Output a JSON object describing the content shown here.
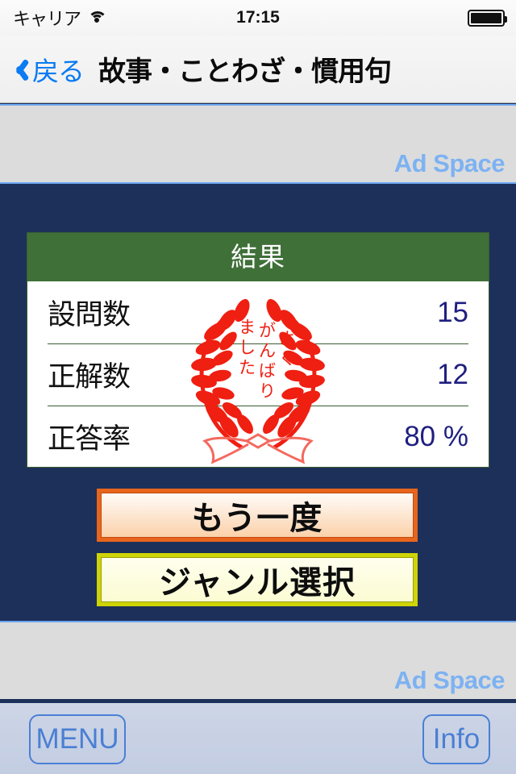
{
  "status_bar": {
    "carrier": "キャリア",
    "wifi_icon": "wifi-icon",
    "time": "17:15",
    "battery_icon": "battery-full-icon"
  },
  "nav_bar": {
    "back_icon": "chevron-left-icon",
    "back_label": "戻る",
    "title": "故事・ことわざ・慣用句"
  },
  "ads": {
    "top_label": "Ad Space",
    "bottom_label": "Ad Space"
  },
  "result_card": {
    "header": "結果",
    "rows": [
      {
        "label": "設問数",
        "value": "15"
      },
      {
        "label": "正解数",
        "value": "12"
      },
      {
        "label": "正答率",
        "value": "80 %"
      }
    ],
    "stamp": {
      "icon": "laurel-wreath-stamp-icon",
      "text_columns": [
        "よく",
        "がんばり",
        "ました"
      ],
      "color": "#ef1f12"
    }
  },
  "actions": {
    "retry_label": "もう一度",
    "genre_label": "ジャンル選択"
  },
  "toolbar": {
    "menu_label": "MENU",
    "info_label": "Info"
  },
  "colors": {
    "background": "#1d3059",
    "card_header_green": "#3f7038",
    "value_navy": "#1f1f80",
    "ad_text_blue": "#7db2f2",
    "link_blue": "#0a7bf2",
    "retry_border_orange": "#e8651d",
    "genre_border_yellow": "#cfd407",
    "toolbar_button_blue": "#4a7fd4"
  }
}
